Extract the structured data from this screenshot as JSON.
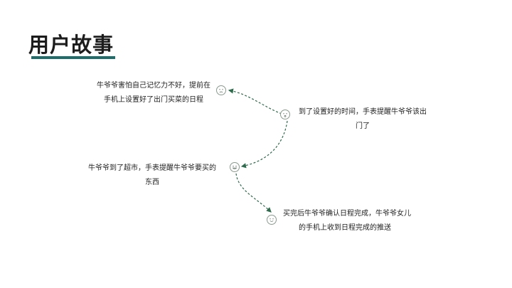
{
  "title": "用户故事",
  "accent_color": "#1d6e6b",
  "connector_color": "#2f6b4d",
  "steps": [
    {
      "line1": "牛爷爷害怕自己记忆力不好，提前在",
      "line2": "手机上设置好了出门买菜的日程",
      "icon": "sad-face-icon"
    },
    {
      "line1": "到了设置好的时间，手表提醒牛爷爷该出",
      "line2": "门了",
      "icon": "neutral-face-icon"
    },
    {
      "line1": "牛爷爷到了超市，手表提醒牛爷爷要买的",
      "line2": "东西",
      "icon": "grin-face-icon"
    },
    {
      "line1": "买完后牛爷爷确认日程完成，牛爷爷女儿",
      "line2": "的手机上收到日程完成的推送",
      "icon": "smile-face-icon"
    }
  ]
}
